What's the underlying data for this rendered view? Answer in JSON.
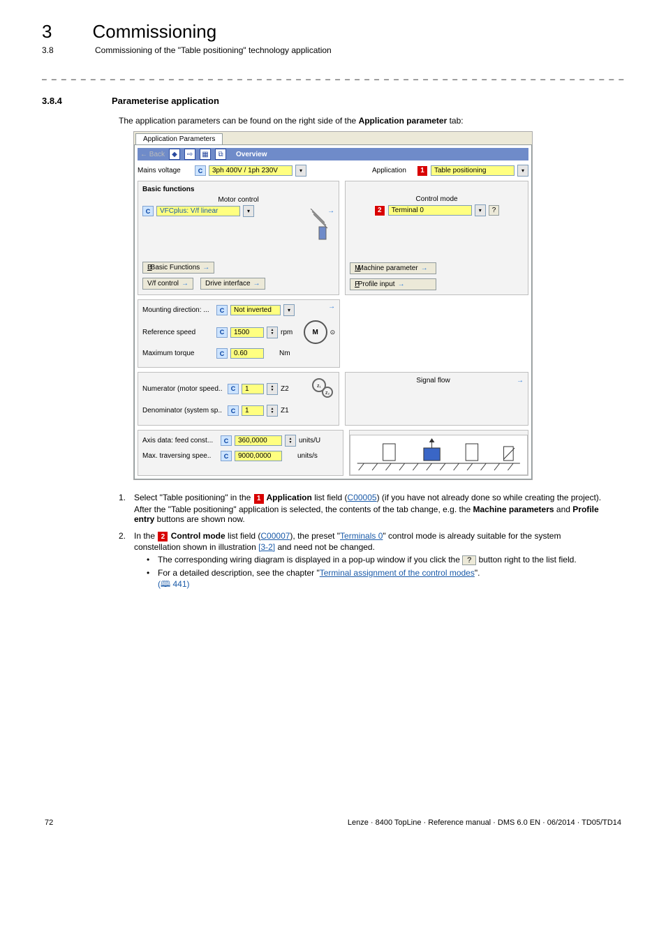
{
  "header": {
    "chapter_num": "3",
    "chapter_title": "Commissioning",
    "sub_num": "3.8",
    "sub_title": "Commissioning of the \"Table positioning\" technology application"
  },
  "section": {
    "num": "3.8.4",
    "title": "Parameterise application",
    "intro_a": "The application parameters can be found on the right side of the ",
    "intro_b": "Application parameter",
    "intro_c": " tab:"
  },
  "shot": {
    "tab_label": "Application Parameters",
    "back": "← Back",
    "overview": "Overview",
    "mains_voltage_lbl": "Mains voltage",
    "mains_voltage_val": "3ph 400V / 1ph 230V",
    "application_lbl": "Application",
    "application_val": "Table positioning",
    "basic_functions": "Basic functions",
    "motor_control_lbl": "Motor control",
    "motor_control_val": "VFCplus: V/f linear",
    "control_mode_lbl": "Control mode",
    "control_mode_val": "Terminal 0",
    "btn_basic_functions": "Basic Functions",
    "btn_vf_control": "V/f control",
    "btn_drive_interface": "Drive interface",
    "btn_machine_param": "Machine parameter",
    "btn_profile_input": "Profile input",
    "mounting_dir_lbl": "Mounting direction: ...",
    "mounting_dir_val": "Not inverted",
    "ref_speed_lbl": "Reference speed",
    "ref_speed_val": "1500",
    "ref_speed_unit": "rpm",
    "max_torque_lbl": "Maximum torque",
    "max_torque_val": "0.60",
    "max_torque_unit": "Nm",
    "numerator_lbl": "Numerator (motor speed..",
    "numerator_val": "1",
    "numerator_unit": "Z2",
    "denom_lbl": "Denominator (system sp..",
    "denom_val": "1",
    "denom_unit": "Z1",
    "feed_const_lbl": "Axis data: feed const...",
    "feed_const_val": "360,0000",
    "feed_const_unit": "units/U",
    "max_trav_lbl": "Max. traversing spee..",
    "max_trav_val": "9000,0000",
    "max_trav_unit": "units/s",
    "signal_flow": "Signal flow",
    "badge1": "1",
    "badge2": "2",
    "help_btn": "?"
  },
  "steps": {
    "s1_a": "Select \"Table positioning\" in the ",
    "s1_b": " Application",
    "s1_c": " list field (",
    "s1_link": "C00005",
    "s1_d": ") (if you have not already done so while creating the project).",
    "s1_note_a": "After the \"Table positioning\" application is selected, the contents of the tab change, e.g. the ",
    "s1_note_b": "Machine parameters",
    "s1_note_c": " and ",
    "s1_note_d": "Profile entry",
    "s1_note_e": " buttons are shown now.",
    "s2_a": "In the ",
    "s2_b": " Control mode",
    "s2_c": " list field (",
    "s2_link1": "C00007",
    "s2_d": "), the preset \"",
    "s2_link2": "Terminals 0",
    "s2_e": "\" control mode is already suitable for the system constellation shown in illustration ",
    "s2_link3": "[3-2]",
    "s2_f": " and need not be changed.",
    "s2_bul1_a": "The corresponding wiring diagram is displayed in a pop-up window if you click the ",
    "s2_bul1_b": " button right to the list field.",
    "s2_bul2_a": "For a detailed description, see the chapter \"",
    "s2_bul2_link": "Terminal assignment of the control modes",
    "s2_bul2_b": "\".",
    "s2_pageref": " 441)"
  },
  "footer": {
    "page": "72",
    "doc": "Lenze · 8400 TopLine · Reference manual · DMS 6.0 EN · 06/2014 · TD05/TD14"
  }
}
